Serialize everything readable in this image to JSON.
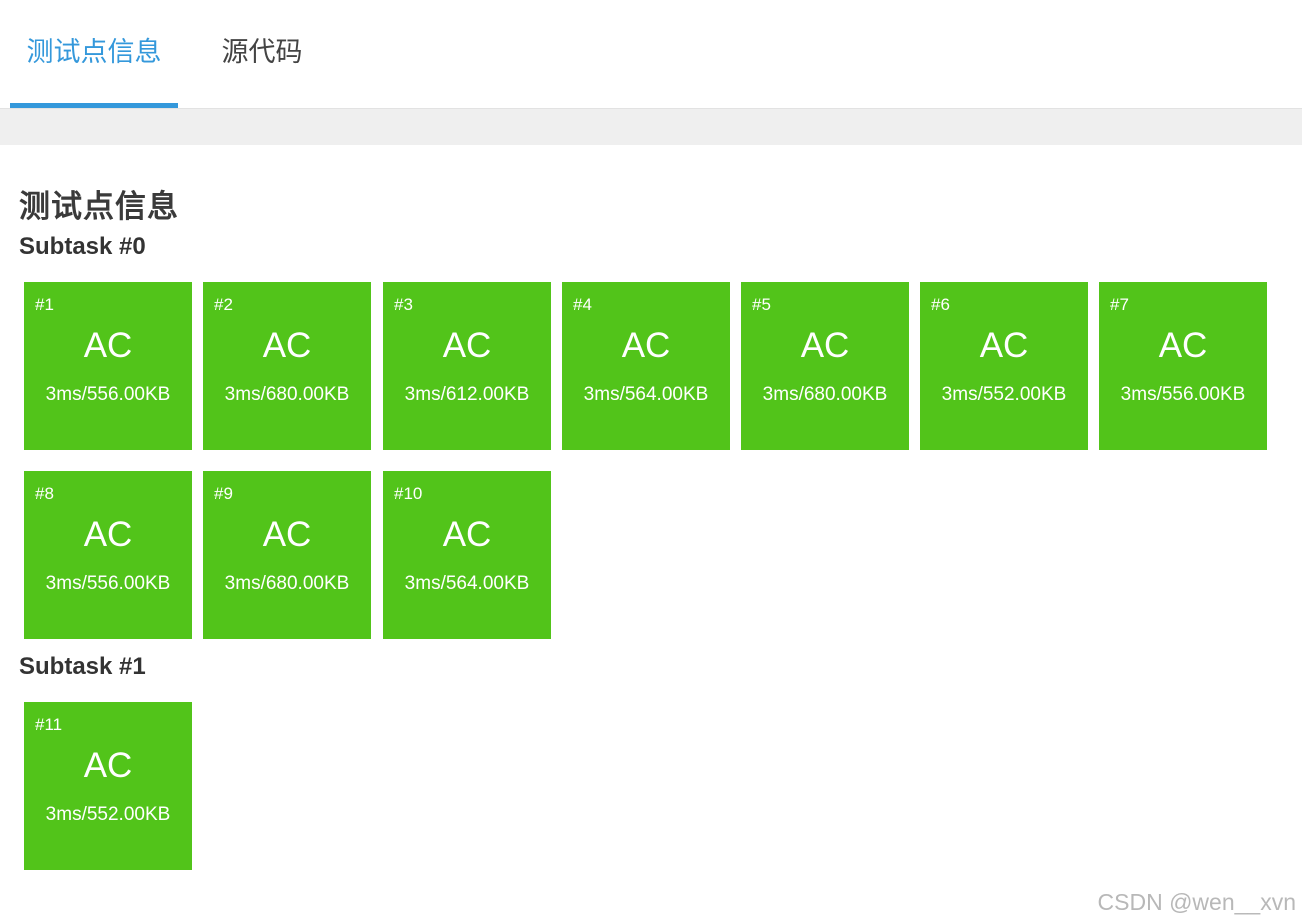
{
  "tabs": [
    {
      "label": "测试点信息",
      "active": true
    },
    {
      "label": "源代码",
      "active": false
    }
  ],
  "section_title": "测试点信息",
  "subtasks": [
    {
      "title": "Subtask #0",
      "cases": [
        {
          "num": "#1",
          "status": "AC",
          "detail": "3ms/556.00KB"
        },
        {
          "num": "#2",
          "status": "AC",
          "detail": "3ms/680.00KB"
        },
        {
          "num": "#3",
          "status": "AC",
          "detail": "3ms/612.00KB"
        },
        {
          "num": "#4",
          "status": "AC",
          "detail": "3ms/564.00KB"
        },
        {
          "num": "#5",
          "status": "AC",
          "detail": "3ms/680.00KB"
        },
        {
          "num": "#6",
          "status": "AC",
          "detail": "3ms/552.00KB"
        },
        {
          "num": "#7",
          "status": "AC",
          "detail": "3ms/556.00KB"
        },
        {
          "num": "#8",
          "status": "AC",
          "detail": "3ms/556.00KB"
        },
        {
          "num": "#9",
          "status": "AC",
          "detail": "3ms/680.00KB"
        },
        {
          "num": "#10",
          "status": "AC",
          "detail": "3ms/564.00KB"
        }
      ]
    },
    {
      "title": "Subtask #1",
      "cases": [
        {
          "num": "#11",
          "status": "AC",
          "detail": "3ms/552.00KB"
        }
      ]
    }
  ],
  "watermark": "CSDN @wen__xvn",
  "colors": {
    "accent": "#3498db",
    "ac_green": "#52c41a",
    "strip_gray": "#efefef"
  }
}
